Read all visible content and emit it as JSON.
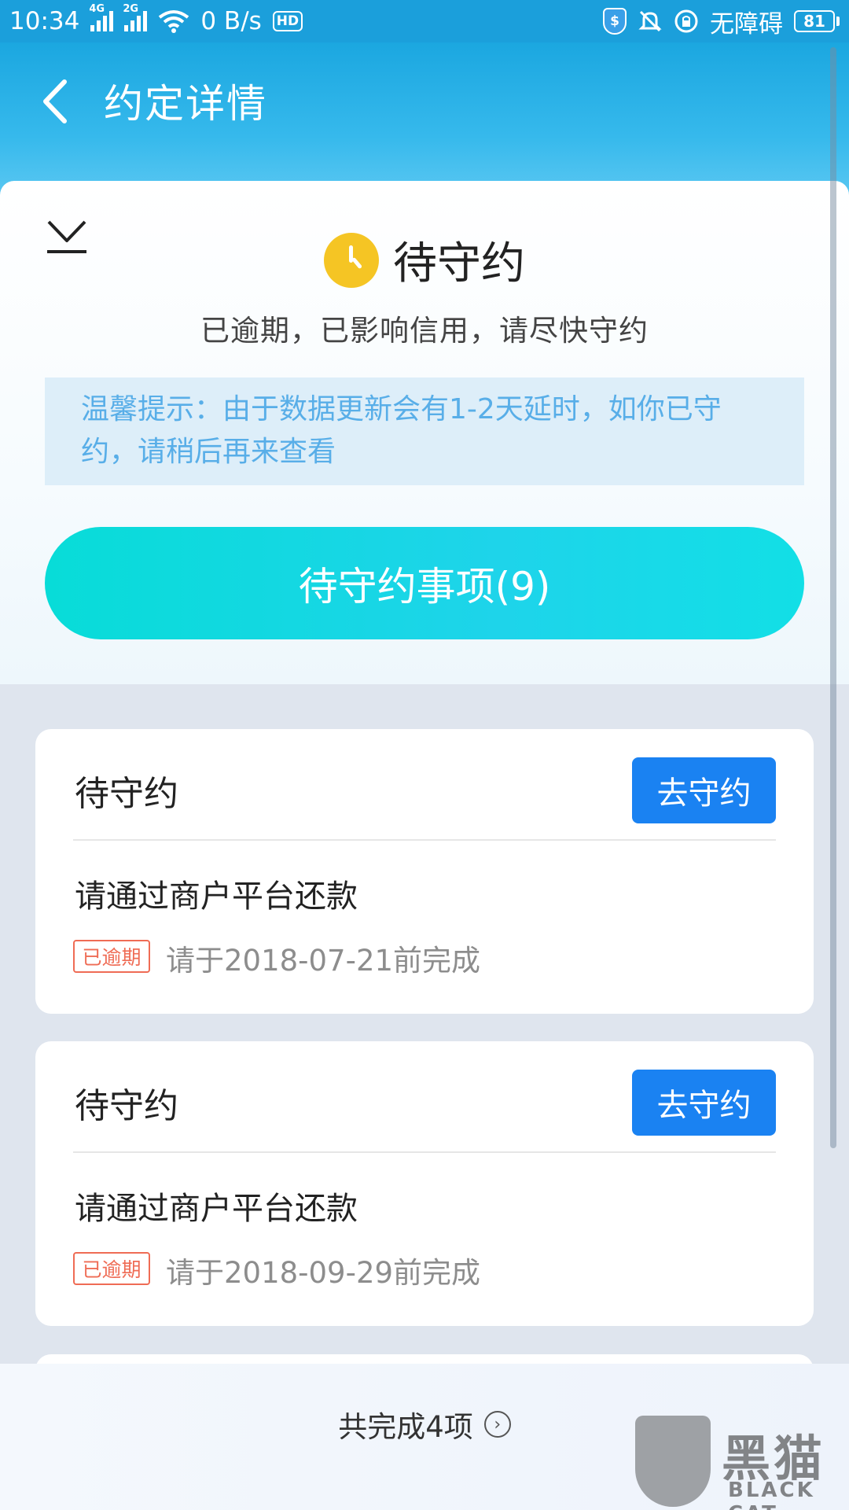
{
  "status_bar": {
    "time": "10:34",
    "net_4g": "4G",
    "net_2g": "2G",
    "speed": "0 B/s",
    "hd": "HD",
    "shield": "$",
    "accessibility": "无障碍",
    "battery": "81"
  },
  "header": {
    "title": "约定详情"
  },
  "summary": {
    "status_title": "待守约",
    "status_desc": "已逾期，已影响信用，请尽快守约",
    "tip": "温馨提示：由于数据更新会有1-2天延时，如你已守约，请稍后再来查看",
    "pending_button": "待守约事项(9)"
  },
  "tasks": [
    {
      "title": "待守约",
      "action": "去守约",
      "name": "请通过商户平台还款",
      "tag": "已逾期",
      "due": "请于2018-07-21前完成"
    },
    {
      "title": "待守约",
      "action": "去守约",
      "name": "请通过商户平台还款",
      "tag": "已逾期",
      "due": "请于2018-09-29前完成"
    }
  ],
  "footer": {
    "completed": "共完成4项",
    "chevron": "›"
  },
  "watermark": {
    "cn": "黑猫",
    "en": "BLACK CAT"
  },
  "colors": {
    "primary": "#1a82f2",
    "cyan": "#08dcd8",
    "overdue": "#ef6c55",
    "tip_text": "#58aee8",
    "clock": "#f5c524"
  }
}
